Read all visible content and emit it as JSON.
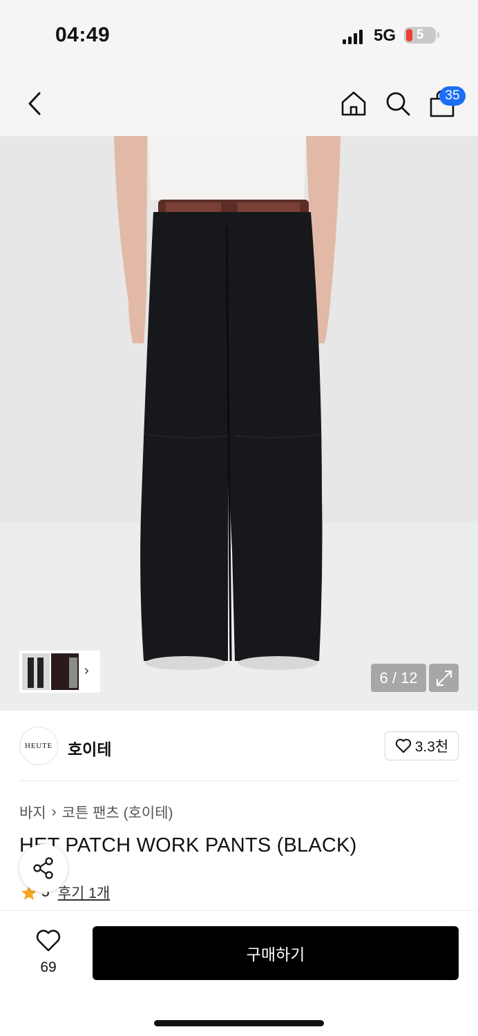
{
  "status_bar": {
    "time": "04:49",
    "network": "5G",
    "battery": "5"
  },
  "nav": {
    "icons": [
      "back-arrow-icon",
      "home-icon",
      "search-icon",
      "shopping-bag-icon"
    ],
    "cart_count": "35"
  },
  "gallery": {
    "counter": "6 / 12",
    "thumb_arrow": "›",
    "expand_icon": "expand-arrows-icon"
  },
  "brand": {
    "logo_text": "HEUTE",
    "name": "호이테",
    "likes": "3.3천"
  },
  "breadcrumb": {
    "parent": "바지",
    "separator": "›",
    "current": "코튼 팬츠 (호이테)"
  },
  "product": {
    "title": "HET PATCH WORK PANTS (BLACK)",
    "rating": "5",
    "reviews": "후기 1개"
  },
  "bottom_bar": {
    "wish_count": "69",
    "buy_label": "구매하기"
  },
  "colors": {
    "accent_badge": "#1b6ef5",
    "star": "#f5a623",
    "buy_button": "#000000"
  }
}
